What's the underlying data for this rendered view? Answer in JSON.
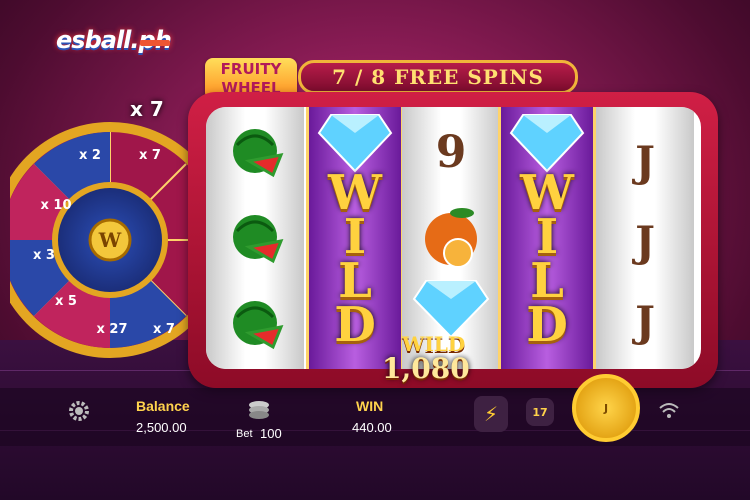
{
  "header": {
    "logo": "esball.ph",
    "game_brand": "FRUITY WHEEL",
    "free_spins": "7 / 8 FREE SPINS"
  },
  "wheel": {
    "multiplier": "x 7",
    "segments": [
      "x 7",
      "x 2",
      "x 10",
      "x 3",
      "x 5",
      "x 27",
      "x 7",
      "x 10"
    ],
    "center": "W"
  },
  "reels": {
    "wild_label": "WILD",
    "symbols": {
      "reel1": [
        "watermelon-icon",
        "watermelon-icon",
        "watermelon-icon"
      ],
      "reel2": [
        "diamond-icon",
        "WILD"
      ],
      "reel3": [
        "9",
        "orange-icon",
        "diamond-icon"
      ],
      "reel4": [
        "diamond-icon",
        "WILD"
      ],
      "reel5": [
        "J",
        "J",
        "J"
      ]
    },
    "win_amount": "1,080",
    "small_wild": "WILD"
  },
  "bottom_bar": {
    "balance_label": "Balance",
    "balance_value": "2,500.00",
    "bet_label": "Bet",
    "bet_value": "100",
    "win_label": "WIN",
    "win_value": "440.00",
    "auto_count": "17",
    "spin_label": "J"
  },
  "colors": {
    "accent_gold": "#ffd23f",
    "cabinet_red": "#c81d40",
    "wild_purple": "#9a3cc9"
  }
}
